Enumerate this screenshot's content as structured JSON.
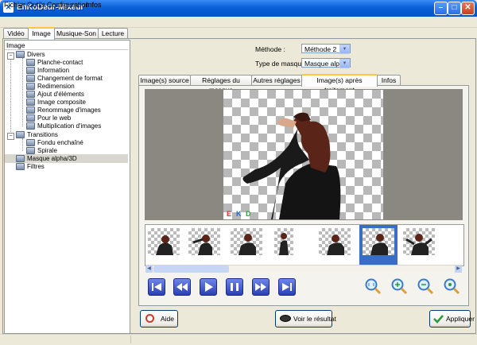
{
  "window": {
    "title": "EnKoDeur-Mixeur"
  },
  "menu": [
    "Fichier",
    "Outils",
    "Configuration",
    "Infos"
  ],
  "main_tabs": [
    "Vidéo",
    "Image",
    "Musique-Son",
    "Lecture"
  ],
  "active_main_tab": "Image",
  "left_panel": {
    "title": "Image",
    "tree": {
      "divers": "Divers",
      "divers_items": [
        "Planche-contact",
        "Information",
        "Changement de format",
        "Redimension",
        "Ajout d'éléments",
        "Image composite",
        "Renommage d'images",
        "Pour le web",
        "Multiplication d'images"
      ],
      "transitions": "Transitions",
      "transitions_items": [
        "Fondu enchaîné",
        "Spirale"
      ],
      "masque": "Masque alpha/3D",
      "filtres": "Filtres"
    }
  },
  "controls": {
    "methode_label": "Méthode :",
    "methode_value": "Méthode 2",
    "type_label": "Type de masque :",
    "type_value": "Masque alpha"
  },
  "sub_tabs": [
    "Image(s) source",
    "Réglages du masque",
    "Autres réglages",
    "Image(s) après traitement",
    "Infos"
  ],
  "active_sub_tab": "Image(s) après traitement",
  "watermark": {
    "e": "E",
    "k": "K",
    "d": "D"
  },
  "thumbnails_count": 7,
  "selected_thumbnail": 6,
  "playback_buttons": [
    "first-icon",
    "rewind-icon",
    "play-icon",
    "pause-icon",
    "fast-forward-icon",
    "last-icon"
  ],
  "zoom_buttons": [
    "zoom-fit-icon",
    "zoom-in-icon",
    "zoom-out-icon",
    "zoom-reset-icon"
  ],
  "buttons": {
    "aide": "Aide",
    "voir": "Voir le résultat",
    "appliquer": "Appliquer"
  },
  "colors": {
    "titlebar": "#0a5fd6",
    "accent_tab": "#ffc83c",
    "selected_thumb": "#3a6ec4"
  }
}
